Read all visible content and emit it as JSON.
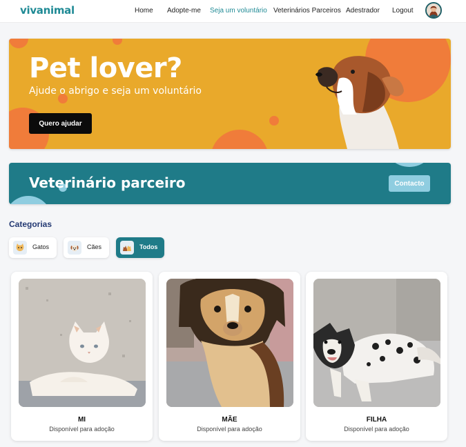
{
  "nav": {
    "logo": "vivanimal",
    "links": [
      "Home",
      "Adopte-me",
      "Seja um voluntário",
      "Veterinários Parceiros",
      "Adestrador",
      "Logout"
    ],
    "active_link": "Seja um voluntário"
  },
  "hero": {
    "title": "Pet lover?",
    "subtitle": "Ajude o abrigo e seja um voluntário",
    "button": "Quero ajudar"
  },
  "vet_banner": {
    "title": "Veterinário parceiro",
    "button": "Contacto"
  },
  "categories": {
    "heading": "Categorias",
    "items": [
      {
        "label": "Gatos",
        "icon": "cat-icon"
      },
      {
        "label": "Cães",
        "icon": "dog-icon"
      },
      {
        "label": "Todos",
        "icon": "all-pets-icon"
      }
    ],
    "selected": "Todos"
  },
  "pets": [
    {
      "name": "MI",
      "status": "Disponível para adoção",
      "photo": "white-cat-photo"
    },
    {
      "name": "MÃE",
      "status": "Disponível para adoção",
      "photo": "brown-dog-photo"
    },
    {
      "name": "FILHA",
      "status": "Disponível para adoção",
      "photo": "black-white-dog-photo"
    }
  ],
  "colors": {
    "accent": "#1f8a95",
    "hero_bg": "#e9a92b",
    "hero_circles": "#f07c3a",
    "vet_bg": "#1f7b88",
    "vet_button": "#8fcde0",
    "heading": "#243a73"
  }
}
